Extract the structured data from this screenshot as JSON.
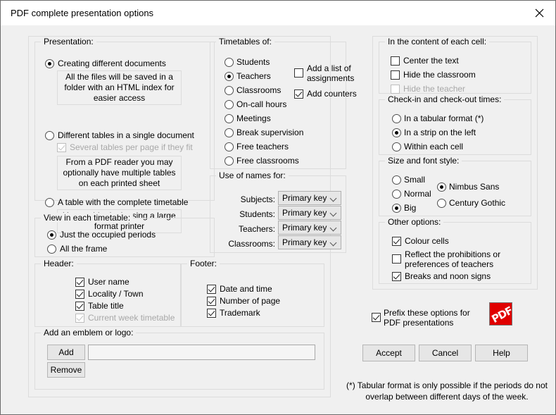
{
  "window": {
    "title": "PDF complete presentation options",
    "close_icon": "close-icon"
  },
  "presentation": {
    "legend": "Presentation:",
    "options": [
      {
        "label": "Creating different documents",
        "selected": true,
        "info": "All the files will be saved in a folder with an HTML index for easier access"
      },
      {
        "label": "Different tables in a single document",
        "selected": false,
        "sub_checkbox": {
          "label": "Several tables per page if they fit",
          "checked": false,
          "disabled": true
        },
        "info": "From a PDF reader you may optionally have multiple tables on each printed sheet"
      },
      {
        "label": "A table with the complete timetable",
        "selected": false,
        "info": "You could print it using a large format printer"
      }
    ]
  },
  "view_in_each_timetable": {
    "legend": "View in each timetable:",
    "options": [
      {
        "label": "Just the occupied periods",
        "selected": true
      },
      {
        "label": "All the frame",
        "selected": false
      }
    ]
  },
  "header": {
    "legend": "Header:",
    "items": [
      {
        "label": "User name",
        "checked": true,
        "disabled": false
      },
      {
        "label": "Locality / Town",
        "checked": true,
        "disabled": false
      },
      {
        "label": "Table title",
        "checked": true,
        "disabled": false
      },
      {
        "label": "Current week timetable",
        "checked": true,
        "disabled": true
      }
    ]
  },
  "footer": {
    "legend": "Footer:",
    "items": [
      {
        "label": "Date and time",
        "checked": true
      },
      {
        "label": "Number of page",
        "checked": true
      },
      {
        "label": "Trademark",
        "checked": true
      }
    ]
  },
  "emblem": {
    "legend": "Add an emblem or logo:",
    "add_label": "Add",
    "remove_label": "Remove",
    "path_value": "",
    "path_placeholder": ""
  },
  "timetables_of": {
    "legend": "Timetables of:",
    "options": [
      {
        "label": "Students",
        "selected": false
      },
      {
        "label": "Teachers",
        "selected": true
      },
      {
        "label": "Classrooms",
        "selected": false
      },
      {
        "label": "On-call hours",
        "selected": false
      },
      {
        "label": "Meetings",
        "selected": false
      },
      {
        "label": "Break supervision",
        "selected": false
      },
      {
        "label": "Free teachers",
        "selected": false
      },
      {
        "label": "Free classrooms",
        "selected": false
      }
    ],
    "extras": [
      {
        "label": "Add a list of assignments",
        "checked": false
      },
      {
        "label": "Add counters",
        "checked": true
      }
    ]
  },
  "use_of_names": {
    "legend": "Use of names for:",
    "rows": [
      {
        "label": "Subjects:",
        "value": "Primary key"
      },
      {
        "label": "Students:",
        "value": "Primary key"
      },
      {
        "label": "Teachers:",
        "value": "Primary key"
      },
      {
        "label": "Classrooms:",
        "value": "Primary key"
      }
    ]
  },
  "cell_content": {
    "legend": "In the content of each cell:",
    "items": [
      {
        "label": "Center the text",
        "checked": false,
        "disabled": false
      },
      {
        "label": "Hide the classroom",
        "checked": false,
        "disabled": false
      },
      {
        "label": "Hide the teacher",
        "checked": false,
        "disabled": true
      }
    ]
  },
  "checkin_times": {
    "legend": "Check-in and check-out times:",
    "options": [
      {
        "label": "In a tabular format (*)",
        "selected": false
      },
      {
        "label": "In a strip on the left",
        "selected": true
      },
      {
        "label": "Within each cell",
        "selected": false
      }
    ]
  },
  "size_font": {
    "legend": "Size and font style:",
    "sizes": [
      {
        "label": "Small",
        "selected": false
      },
      {
        "label": "Normal",
        "selected": false
      },
      {
        "label": "Big",
        "selected": true
      }
    ],
    "fonts": [
      {
        "label": "Nimbus Sans",
        "selected": true
      },
      {
        "label": "Century Gothic",
        "selected": false
      }
    ]
  },
  "other_options": {
    "legend": "Other options:",
    "items": [
      {
        "label": "Colour cells",
        "checked": true
      },
      {
        "label": "Reflect the prohibitions or preferences of teachers",
        "checked": false
      },
      {
        "label": "Breaks and noon signs",
        "checked": true
      }
    ]
  },
  "prefix": {
    "label": "Prefix these options for PDF presentations",
    "checked": true,
    "logo_text": "PDF",
    "logo_color": "#e00000"
  },
  "actions": {
    "accept": "Accept",
    "cancel": "Cancel",
    "help": "Help"
  },
  "footnote": "(*)  Tabular format is only possible if the periods do not\noverlap between different days of the week."
}
